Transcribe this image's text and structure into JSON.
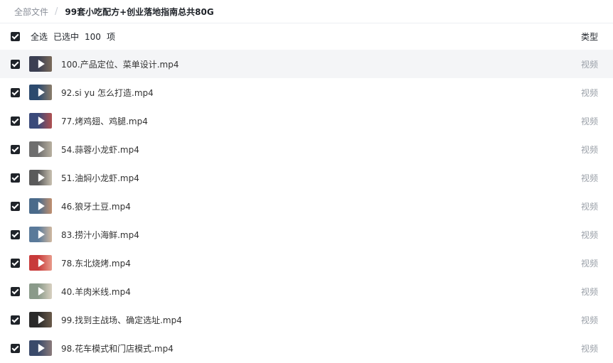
{
  "breadcrumb": {
    "root": "全部文件",
    "separator": "/",
    "current": "99套小吃配方+创业落地指南总共80G"
  },
  "header": {
    "select_all": "全选",
    "selected_label": "已选中",
    "selected_count": "100",
    "selected_unit": "项",
    "type_column": "类型"
  },
  "files": [
    {
      "name": "100.产品定位、菜单设计.mp4",
      "type": "视频",
      "checked": true,
      "thumb_colors": [
        "#3b3f52",
        "#7a6a5a"
      ]
    },
    {
      "name": "92.si yu 怎么打造.mp4",
      "type": "视频",
      "checked": true,
      "thumb_colors": [
        "#2c4a6e",
        "#8a7c6a"
      ]
    },
    {
      "name": "77.烤鸡翅、鸡腿.mp4",
      "type": "视频",
      "checked": true,
      "thumb_colors": [
        "#3a4a7a",
        "#b05050"
      ]
    },
    {
      "name": "54.蒜蓉小龙虾.mp4",
      "type": "视频",
      "checked": true,
      "thumb_colors": [
        "#6e6e6e",
        "#b8b0a0"
      ]
    },
    {
      "name": "51.油焖小龙虾.mp4",
      "type": "视频",
      "checked": true,
      "thumb_colors": [
        "#5a5a5a",
        "#c8c0b0"
      ]
    },
    {
      "name": "46.狼牙土豆.mp4",
      "type": "视频",
      "checked": true,
      "thumb_colors": [
        "#4a6a8a",
        "#c09070"
      ]
    },
    {
      "name": "83.捞汁小海鲜.mp4",
      "type": "视频",
      "checked": true,
      "thumb_colors": [
        "#5a7a9a",
        "#d0b8a0"
      ]
    },
    {
      "name": "78.东北烧烤.mp4",
      "type": "视频",
      "checked": true,
      "thumb_colors": [
        "#c83a3a",
        "#e89a8a"
      ]
    },
    {
      "name": "40.羊肉米线.mp4",
      "type": "视频",
      "checked": true,
      "thumb_colors": [
        "#8a9a8a",
        "#d8d0c0"
      ]
    },
    {
      "name": "99.找到主战场、确定选址.mp4",
      "type": "视频",
      "checked": true,
      "thumb_colors": [
        "#2a2a2a",
        "#6a5a4a"
      ]
    },
    {
      "name": "98.花车模式和门店模式.mp4",
      "type": "视频",
      "checked": true,
      "thumb_colors": [
        "#3a4a6a",
        "#8a7a7a"
      ]
    }
  ],
  "icons": {
    "checkbox": "checkbox-checked-icon",
    "play": "play-icon"
  },
  "colors": {
    "checkbox": "#1f2329",
    "type_text": "#9aa0a8",
    "highlight_row": "#f4f5f7"
  }
}
